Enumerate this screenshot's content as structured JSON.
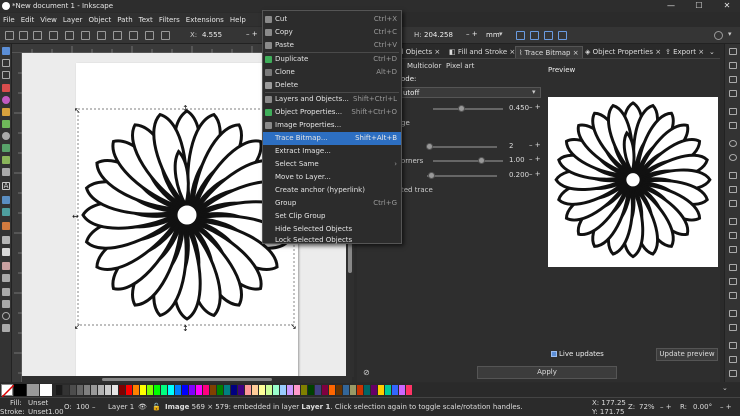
{
  "window": {
    "title": "*New document 1 - Inkscape",
    "minimize": "—",
    "maximize": "☐",
    "close": "✕"
  },
  "menubar": [
    "File",
    "Edit",
    "View",
    "Layer",
    "Object",
    "Path",
    "Text",
    "Filters",
    "Extensions",
    "Help"
  ],
  "toolctl": {
    "x_label": "X:",
    "x_value": "4.555",
    "h_label": "H:",
    "h_value": "204.258",
    "unit": "mm"
  },
  "context_menu": [
    {
      "label": "Cut",
      "shortcut": "Ctrl+X",
      "icon": "cut-icon"
    },
    {
      "label": "Copy",
      "shortcut": "Ctrl+C",
      "icon": "copy-icon"
    },
    {
      "label": "Paste",
      "shortcut": "Ctrl+V",
      "icon": "paste-icon"
    },
    {
      "label": "Duplicate",
      "shortcut": "Ctrl+D",
      "icon": "duplicate-icon"
    },
    {
      "label": "Clone",
      "shortcut": "Alt+D",
      "icon": "clone-icon"
    },
    {
      "label": "Delete",
      "shortcut": "",
      "icon": "delete-icon"
    },
    {
      "label": "Layers and Objects...",
      "shortcut": "Shift+Ctrl+L",
      "icon": "layers-icon"
    },
    {
      "label": "Object Properties...",
      "shortcut": "Shift+Ctrl+O",
      "icon": "object-properties-icon"
    },
    {
      "label": "Image Properties...",
      "shortcut": "",
      "icon": "image-properties-icon"
    },
    {
      "label": "Trace Bitmap...",
      "shortcut": "Shift+Alt+B",
      "icon": "trace-bitmap-icon"
    },
    {
      "label": "Extract Image...",
      "shortcut": "",
      "icon": ""
    },
    {
      "label": "Select Same",
      "shortcut": "›",
      "icon": ""
    },
    {
      "label": "Move to Layer...",
      "shortcut": "",
      "icon": ""
    },
    {
      "label": "Create anchor (hyperlink)",
      "shortcut": "",
      "icon": ""
    },
    {
      "label": "Group",
      "shortcut": "Ctrl+G",
      "icon": ""
    },
    {
      "label": "Set Clip Group",
      "shortcut": "",
      "icon": ""
    },
    {
      "label": "Hide Selected Objects",
      "shortcut": "",
      "icon": ""
    },
    {
      "label": "Lock Selected Objects",
      "shortcut": "",
      "icon": ""
    }
  ],
  "dock": {
    "tabs": [
      "d Objects",
      "Fill and Stroke",
      "Trace Bitmap",
      "Object Properties",
      "Export"
    ],
    "tab_close": "×",
    "subtabs": [
      "Multicolor",
      "Pixel art"
    ],
    "mode_label": "ode:",
    "mode_value": "utoff",
    "threshold_value": "0.450",
    "edge_label": "ge",
    "speckles_value": "2",
    "corners_label": "orners",
    "corners_value": "1.00",
    "optimize_value": "0.200",
    "trace_label": "ted trace",
    "preview_label": "Preview",
    "live_updates_label": "Live updates",
    "live_updates_checked": true,
    "update_preview_label": "Update preview",
    "apply_label": "Apply"
  },
  "status": {
    "fill_label": "Fill:",
    "fill_value": "Unset",
    "stroke_label": "Stroke:",
    "stroke_value": "Unset",
    "stroke_width": "1.00",
    "opacity_label": "O:",
    "opacity_value": "100",
    "layer_value": "Layer 1",
    "message_bold": "Image",
    "message_rest": "569 × 579: embedded in layer",
    "message_layer": "Layer 1",
    "message_tail": ". Click selection again to toggle scale/rotation handles.",
    "x_coord": "X: 177.25",
    "y_coord": "Y: 171.75",
    "zoom_label": "Z:",
    "zoom_value": "72%",
    "rotate_label": "R:",
    "rotate_value": "0.00°"
  },
  "colors": {
    "highlight": "#2d6fc2",
    "palette": [
      "#000000",
      "#ffffff",
      "#808080",
      "#c0c0c0",
      "#800000",
      "#ff0000",
      "#ff8000",
      "#ffff00",
      "#80ff00",
      "#00ff00",
      "#00ff80",
      "#00ffff",
      "#0080ff",
      "#0000ff",
      "#8000ff",
      "#ff00ff",
      "#ff0080",
      "#804000",
      "#008000",
      "#008080",
      "#000080",
      "#400080"
    ]
  }
}
